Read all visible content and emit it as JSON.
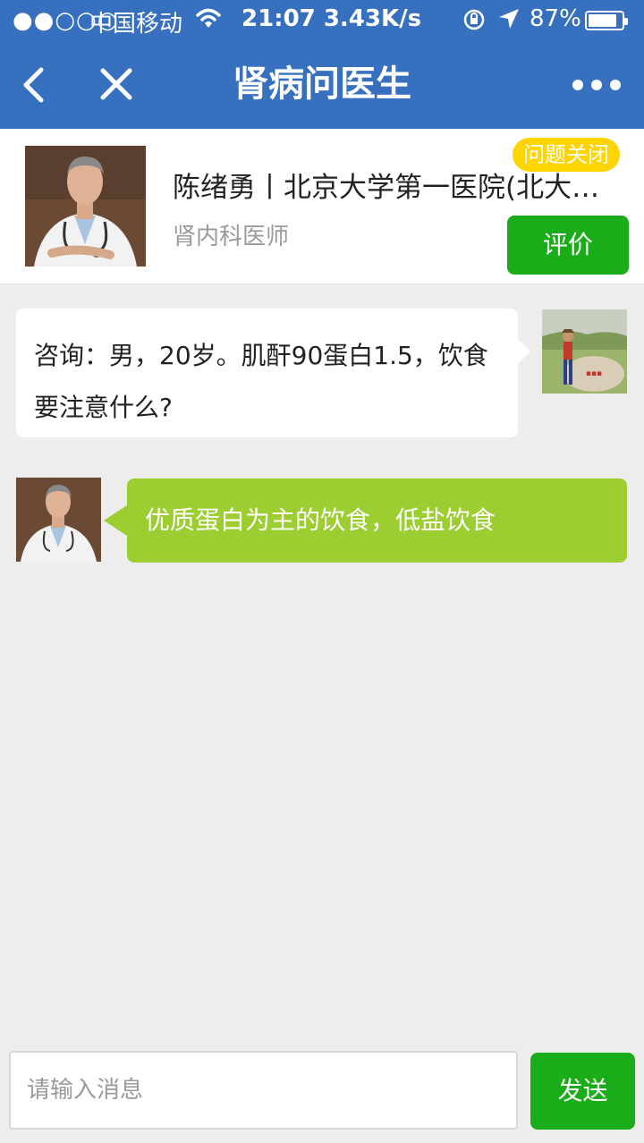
{
  "status_bar": {
    "signal": "●●○○○",
    "carrier": "中国移动",
    "time": "21:07 3.43K/s",
    "battery_pct": "87%",
    "battery_level": 0.87
  },
  "nav": {
    "title": "肾病问医生"
  },
  "doctor": {
    "name": "陈绪勇丨北京大学第一医院(北大…",
    "dept": "肾内科医师",
    "badge": "问题关闭",
    "rate_label": "评价"
  },
  "messages": [
    {
      "from": "user",
      "text": "咨询：男，20岁。肌酐90蛋白1.5，饮食要注意什么?"
    },
    {
      "from": "doctor",
      "text": "优质蛋白为主的饮食，低盐饮食"
    }
  ],
  "input": {
    "placeholder": "请输入消息",
    "value": "",
    "send_label": "发送"
  },
  "colors": {
    "header": "#3670bf",
    "primary_green": "#1aad19",
    "doctor_bubble": "#9ccd31",
    "badge": "#ffd400",
    "background": "#ededed"
  },
  "icons": {
    "back": "chevron-left-icon",
    "close": "close-icon",
    "more": "more-icon",
    "wifi": "wifi-icon",
    "rotation_lock": "rotation-lock-icon",
    "location": "location-arrow-icon",
    "battery": "battery-icon"
  }
}
